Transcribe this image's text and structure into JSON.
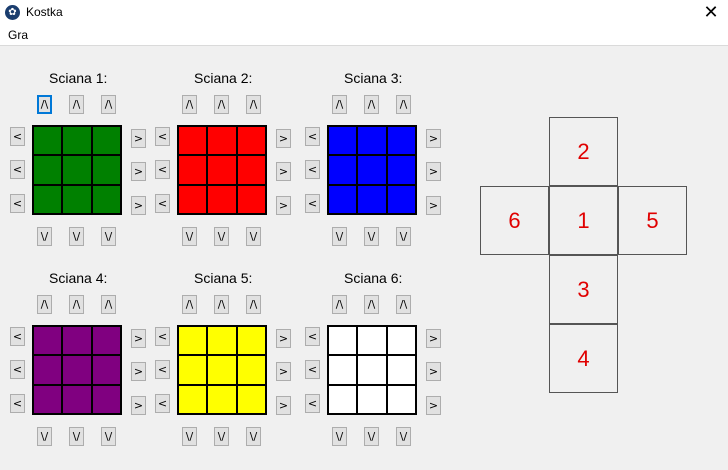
{
  "window": {
    "title": "Kostka",
    "close_glyph": "✕",
    "icon": "paw-icon"
  },
  "menu": {
    "items": [
      "Gra"
    ]
  },
  "controls": {
    "up": "/\\",
    "down": "\\/",
    "left": "<",
    "right": ">"
  },
  "faces": [
    {
      "label": "Sciana 1:",
      "color": "#008000",
      "cells": [
        "#008000",
        "#008000",
        "#008000",
        "#008000",
        "#008000",
        "#008000",
        "#008000",
        "#008000",
        "#008000"
      ]
    },
    {
      "label": "Sciana 2:",
      "color": "#ff0000",
      "cells": [
        "#ff0000",
        "#ff0000",
        "#ff0000",
        "#ff0000",
        "#ff0000",
        "#ff0000",
        "#ff0000",
        "#ff0000",
        "#ff0000"
      ]
    },
    {
      "label": "Sciana 3:",
      "color": "#0000ff",
      "cells": [
        "#0000ff",
        "#0000ff",
        "#0000ff",
        "#0000ff",
        "#0000ff",
        "#0000ff",
        "#0000ff",
        "#0000ff",
        "#0000ff"
      ]
    },
    {
      "label": "Sciana 4:",
      "color": "#800080",
      "cells": [
        "#800080",
        "#800080",
        "#800080",
        "#800080",
        "#800080",
        "#800080",
        "#800080",
        "#800080",
        "#800080"
      ]
    },
    {
      "label": "Sciana 5:",
      "color": "#ffff00",
      "cells": [
        "#ffff00",
        "#ffff00",
        "#ffff00",
        "#ffff00",
        "#ffff00",
        "#ffff00",
        "#ffff00",
        "#ffff00",
        "#ffff00"
      ]
    },
    {
      "label": "Sciana 6:",
      "color": "#ffffff",
      "cells": [
        "#ffffff",
        "#ffffff",
        "#ffffff",
        "#ffffff",
        "#ffffff",
        "#ffffff",
        "#ffffff",
        "#ffffff",
        "#ffffff"
      ]
    }
  ],
  "net": {
    "labels": [
      "2",
      "6",
      "1",
      "5",
      "3",
      "4"
    ],
    "label_color": "#e00000"
  }
}
